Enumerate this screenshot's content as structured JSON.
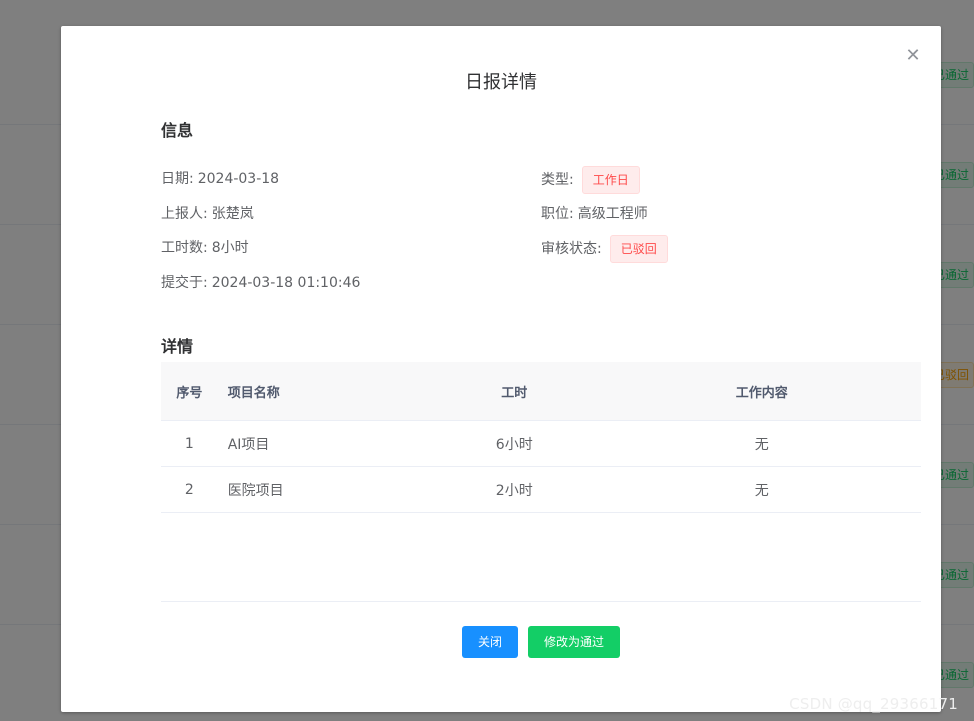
{
  "background": {
    "row_tags": [
      {
        "text": "已通过",
        "kind": "success"
      },
      {
        "text": "已通过",
        "kind": "success"
      },
      {
        "text": "已通过",
        "kind": "success"
      },
      {
        "text": "已驳回",
        "kind": "warning"
      },
      {
        "text": "已通过",
        "kind": "success"
      },
      {
        "text": "已通过",
        "kind": "success"
      },
      {
        "text": "已通过",
        "kind": "success"
      }
    ]
  },
  "dialog": {
    "title": "日报详情",
    "close_icon": "close-icon"
  },
  "info": {
    "section_title": "信息",
    "date_label": "日期:",
    "date_value": "2024-03-18",
    "reporter_label": "上报人:",
    "reporter_value": "张楚岚",
    "hours_label": "工时数:",
    "hours_value": "8小时",
    "submitted_label": "提交于:",
    "submitted_value": "2024-03-18 01:10:46",
    "type_label": "类型:",
    "type_value": "工作日",
    "position_label": "职位:",
    "position_value": "高级工程师",
    "status_label": "审核状态:",
    "status_value": "已驳回"
  },
  "details": {
    "section_title": "详情",
    "columns": [
      "序号",
      "项目名称",
      "工时",
      "工作内容"
    ],
    "rows": [
      {
        "index": "1",
        "project": "AI项目",
        "hours": "6小时",
        "content": "无"
      },
      {
        "index": "2",
        "project": "医院项目",
        "hours": "2小时",
        "content": "无"
      }
    ]
  },
  "footer": {
    "close_label": "关闭",
    "approve_label": "修改为通过"
  },
  "watermark": "CSDN @qq_29366171",
  "colors": {
    "primary": "#1890ff",
    "success": "#13ce66",
    "danger": "#ff4949",
    "warning": "#ffa400"
  }
}
